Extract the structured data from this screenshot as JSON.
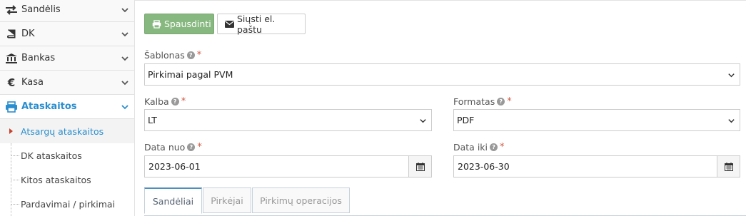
{
  "sidebar": {
    "items": [
      {
        "label": "Sandėlis",
        "icon": "exchange-arrows-icon"
      },
      {
        "label": "DK",
        "icon": "book-icon"
      },
      {
        "label": "Bankas",
        "icon": "bank-icon"
      },
      {
        "label": "Kasa",
        "icon": "euro-icon"
      },
      {
        "label": "Ataskaitos",
        "icon": "printer-icon",
        "active": true
      }
    ],
    "subitems": [
      {
        "label": "Atsargų ataskaitos",
        "current": true
      },
      {
        "label": "DK ataskaitos"
      },
      {
        "label": "Kitos ataskaitos"
      },
      {
        "label": "Pardavimai / pirkimai"
      }
    ]
  },
  "toolbar": {
    "print_label": "Spausdinti",
    "email_label": "Siųsti el. paštu"
  },
  "form": {
    "template": {
      "label": "Šablonas",
      "value": "Pirkimai pagal PVM"
    },
    "language": {
      "label": "Kalba",
      "value": "LT"
    },
    "format": {
      "label": "Formatas",
      "value": "PDF"
    },
    "date_from": {
      "label": "Data nuo",
      "value": "2023-06-01"
    },
    "date_to": {
      "label": "Data iki",
      "value": "2023-06-30"
    },
    "required_mark": "*",
    "help_glyph": "?"
  },
  "tabs": [
    {
      "label": "Sandėliai",
      "active": true
    },
    {
      "label": "Pirkėjai"
    },
    {
      "label": "Pirkimų operacijos"
    }
  ],
  "colors": {
    "accent": "#2a8ece",
    "print_button": "#87b87f",
    "required": "#d15b47"
  }
}
